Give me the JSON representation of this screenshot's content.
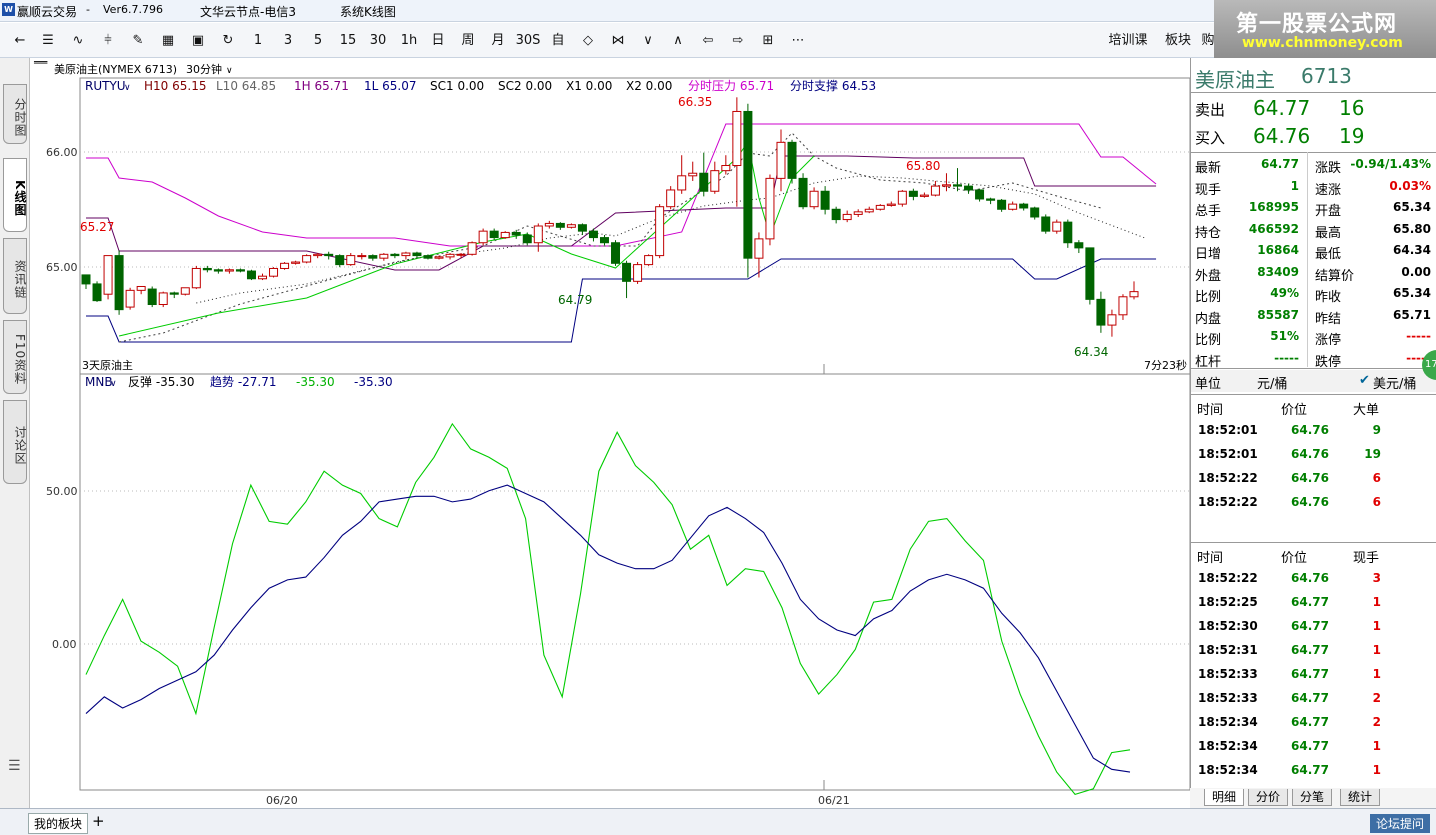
{
  "window": {
    "title": "赢顺云交易",
    "version": "Ver6.7.796",
    "node": "文华云节点-电信3",
    "mode": "系统K线图"
  },
  "logo": {
    "line1": "第一股票公式网",
    "line2": "www.chnmoney.com"
  },
  "toolbar": {
    "items": [
      "1",
      "3",
      "5",
      "15",
      "30",
      "1h",
      "日",
      "周",
      "月",
      "30S",
      "自"
    ],
    "right": [
      "培训课",
      "板块",
      "购"
    ]
  },
  "lefttabs": [
    "分时图",
    "K线图",
    "资讯链",
    "F10资料",
    "讨论区"
  ],
  "chart": {
    "header": {
      "symbol": "美原油主(NYMEX 6713)",
      "period": "30分钟"
    },
    "indicator_line": {
      "name": "RUTYU",
      "h10": "H10 65.15",
      "l10": "L10 64.85",
      "h1": "1H 65.71",
      "l1": "1L 65.07",
      "sc1": "SC1 0.00",
      "sc2": "SC2 0.00",
      "x1": "X1 0.00",
      "x2": "X2 0.00",
      "press": "分时压力 65.71",
      "support": "分时支撑 64.53"
    },
    "price_labels": {
      "p1": "66.00",
      "p2": "65.00"
    },
    "annotations": {
      "a1": "66.35",
      "a2": "65.80",
      "a3": "65.27",
      "a4": "64.79",
      "a5": "64.34",
      "a6": "3天原油主"
    },
    "countdown": "7分23秒",
    "mnb": {
      "name": "MNB",
      "rebound": "反弹 -35.30",
      "trend": "趋势 -27.71",
      "v3": "-35.30",
      "v4": "-35.30"
    },
    "mnb_labels": {
      "p1": "50.00",
      "p2": "0.00"
    },
    "dates": {
      "d1": "06/20",
      "d2": "06/21"
    }
  },
  "chart_data": {
    "type": "candlestick",
    "price_ylim": [
      64.2,
      66.5
    ],
    "candles": [
      [
        64.97,
        64.9,
        64.86,
        64.97
      ],
      [
        64.9,
        64.77,
        64.76,
        64.92
      ],
      [
        64.82,
        65.12,
        64.78,
        65.12
      ],
      [
        65.12,
        64.7,
        64.66,
        65.16
      ],
      [
        64.72,
        64.85,
        64.7,
        64.87
      ],
      [
        64.85,
        64.88,
        64.82,
        64.88
      ],
      [
        64.86,
        64.74,
        64.72,
        64.88
      ],
      [
        64.74,
        64.83,
        64.72,
        64.84
      ],
      [
        64.83,
        64.82,
        64.79,
        64.84
      ],
      [
        64.82,
        64.87,
        64.81,
        64.87
      ],
      [
        64.87,
        65.02,
        64.86,
        65.04
      ],
      [
        65.02,
        65.01,
        64.99,
        65.04
      ],
      [
        65.01,
        65.0,
        64.98,
        65.02
      ],
      [
        65.0,
        65.01,
        64.98,
        65.02
      ],
      [
        65.01,
        65.0,
        64.99,
        65.02
      ],
      [
        65.0,
        64.94,
        64.93,
        65.01
      ],
      [
        64.94,
        64.96,
        64.93,
        64.98
      ],
      [
        64.96,
        65.02,
        64.95,
        65.03
      ],
      [
        65.02,
        65.06,
        65.01,
        65.07
      ],
      [
        65.06,
        65.07,
        65.05,
        65.08
      ],
      [
        65.07,
        65.12,
        65.06,
        65.13
      ],
      [
        65.12,
        65.13,
        65.1,
        65.14
      ],
      [
        65.13,
        65.12,
        65.09,
        65.15
      ],
      [
        65.12,
        65.05,
        65.03,
        65.13
      ],
      [
        65.05,
        65.12,
        65.04,
        65.14
      ],
      [
        65.12,
        65.12,
        65.09,
        65.14
      ],
      [
        65.12,
        65.1,
        65.08,
        65.13
      ],
      [
        65.1,
        65.13,
        65.08,
        65.14
      ],
      [
        65.13,
        65.12,
        65.1,
        65.14
      ],
      [
        65.12,
        65.14,
        65.09,
        65.15
      ],
      [
        65.14,
        65.12,
        65.1,
        65.15
      ],
      [
        65.12,
        65.1,
        65.09,
        65.13
      ],
      [
        65.1,
        65.11,
        65.09,
        65.12
      ],
      [
        65.11,
        65.13,
        65.09,
        65.14
      ],
      [
        65.13,
        65.13,
        65.1,
        65.14
      ],
      [
        65.13,
        65.22,
        65.12,
        65.23
      ],
      [
        65.22,
        65.31,
        65.2,
        65.33
      ],
      [
        65.31,
        65.26,
        65.24,
        65.33
      ],
      [
        65.26,
        65.3,
        65.25,
        65.31
      ],
      [
        65.3,
        65.28,
        65.25,
        65.32
      ],
      [
        65.28,
        65.22,
        65.2,
        65.3
      ],
      [
        65.22,
        65.35,
        65.15,
        65.37
      ],
      [
        65.35,
        65.37,
        65.33,
        65.39
      ],
      [
        65.37,
        65.34,
        65.32,
        65.38
      ],
      [
        65.34,
        65.36,
        65.33,
        65.37
      ],
      [
        65.36,
        65.31,
        65.28,
        65.37
      ],
      [
        65.31,
        65.26,
        65.23,
        65.33
      ],
      [
        65.26,
        65.22,
        65.2,
        65.28
      ],
      [
        65.22,
        65.06,
        65.04,
        65.24
      ],
      [
        65.06,
        64.92,
        64.79,
        65.08
      ],
      [
        64.92,
        65.05,
        64.9,
        65.07
      ],
      [
        65.05,
        65.12,
        65.04,
        65.13
      ],
      [
        65.12,
        65.5,
        65.1,
        65.52
      ],
      [
        65.5,
        65.63,
        65.48,
        65.66
      ],
      [
        65.63,
        65.74,
        65.6,
        65.9
      ],
      [
        65.74,
        65.76,
        65.7,
        65.85
      ],
      [
        65.76,
        65.62,
        65.58,
        65.92
      ],
      [
        65.62,
        65.78,
        65.6,
        65.85
      ],
      [
        65.78,
        65.82,
        65.75,
        65.9
      ],
      [
        65.82,
        66.24,
        65.5,
        66.35
      ],
      [
        66.24,
        65.1,
        64.95,
        66.3
      ],
      [
        65.1,
        65.25,
        64.95,
        65.3
      ],
      [
        65.25,
        65.72,
        65.2,
        65.75
      ],
      [
        65.72,
        66.0,
        65.62,
        66.1
      ],
      [
        66.0,
        65.72,
        65.68,
        66.02
      ],
      [
        65.72,
        65.5,
        65.48,
        65.76
      ],
      [
        65.5,
        65.62,
        65.48,
        65.65
      ],
      [
        65.62,
        65.48,
        65.44,
        65.66
      ],
      [
        65.48,
        65.4,
        65.37,
        65.5
      ],
      [
        65.4,
        65.44,
        65.38,
        65.47
      ],
      [
        65.44,
        65.46,
        65.42,
        65.48
      ],
      [
        65.46,
        65.48,
        65.45,
        65.5
      ],
      [
        65.48,
        65.51,
        65.47,
        65.52
      ],
      [
        65.51,
        65.52,
        65.5,
        65.54
      ],
      [
        65.52,
        65.62,
        65.5,
        65.63
      ],
      [
        65.62,
        65.58,
        65.55,
        65.64
      ],
      [
        65.58,
        65.59,
        65.57,
        65.61
      ],
      [
        65.59,
        65.66,
        65.58,
        65.7
      ],
      [
        65.66,
        65.67,
        65.62,
        65.76
      ],
      [
        65.67,
        65.66,
        65.62,
        65.8
      ],
      [
        65.66,
        65.63,
        65.6,
        65.68
      ],
      [
        65.63,
        65.56,
        65.54,
        65.64
      ],
      [
        65.56,
        65.55,
        65.52,
        65.57
      ],
      [
        65.55,
        65.48,
        65.46,
        65.56
      ],
      [
        65.48,
        65.52,
        65.47,
        65.54
      ],
      [
        65.52,
        65.49,
        65.47,
        65.53
      ],
      [
        65.49,
        65.42,
        65.4,
        65.5
      ],
      [
        65.42,
        65.31,
        65.29,
        65.44
      ],
      [
        65.31,
        65.38,
        65.29,
        65.4
      ],
      [
        65.38,
        65.22,
        65.18,
        65.4
      ],
      [
        65.22,
        65.18,
        65.14,
        65.24
      ],
      [
        65.18,
        64.78,
        64.74,
        65.18
      ],
      [
        64.78,
        64.58,
        64.52,
        64.84
      ],
      [
        64.58,
        64.66,
        64.49,
        64.7
      ],
      [
        64.66,
        64.8,
        64.62,
        64.82
      ],
      [
        64.8,
        64.84,
        64.78,
        64.92
      ]
    ],
    "mnb_ylim": [
      -50,
      90
    ],
    "mnb_green": [
      -10,
      4,
      17,
      2,
      -2,
      -7,
      -24,
      7,
      37,
      58,
      45,
      44,
      52,
      63,
      58,
      55,
      46,
      43,
      59,
      68,
      80,
      71,
      68,
      64,
      46,
      -3,
      -18,
      19,
      63,
      77,
      65,
      59,
      51,
      35,
      40,
      22,
      28,
      27,
      14,
      -6,
      -17,
      -10,
      -1,
      16,
      17,
      35,
      45,
      46,
      38,
      31,
      2,
      -17,
      -32,
      -45,
      -53,
      -51,
      -38,
      -37
    ],
    "mnb_blue": [
      -24,
      -18,
      -22,
      -19,
      -15,
      -12,
      -9,
      -3,
      6,
      14,
      21,
      24,
      25,
      32,
      40,
      45,
      52,
      53,
      54,
      54,
      52,
      53,
      56,
      58,
      55,
      52,
      46,
      40,
      33,
      30,
      28,
      28,
      31,
      39,
      47,
      50,
      46,
      41,
      30,
      17,
      10,
      6,
      4,
      10,
      13,
      20,
      24,
      26,
      24,
      21,
      12,
      5,
      -4,
      -16,
      -28,
      -40,
      -44,
      -45
    ],
    "ma_dash": [
      65.0,
      64.98,
      64.9,
      64.88,
      64.88,
      64.9,
      64.9,
      64.92,
      64.94,
      64.96,
      65.0,
      65.02,
      65.05,
      65.08,
      65.1,
      65.14,
      65.18,
      65.2,
      65.2,
      65.15,
      65.08,
      65.06,
      65.1,
      65.22,
      65.35,
      65.5,
      65.6,
      65.75,
      65.82,
      65.85,
      65.82,
      65.75,
      65.72,
      65.7,
      65.72,
      65.75,
      65.78,
      65.79,
      65.78,
      65.76,
      65.72,
      65.66,
      65.58,
      65.48,
      65.34,
      65.22,
      65.16
    ]
  },
  "quote": {
    "title": "美原油主",
    "code": "6713",
    "sell_label": "卖出",
    "sell_price": "64.77",
    "sell_vol": "16",
    "buy_label": "买入",
    "buy_price": "64.76",
    "buy_vol": "19",
    "rows": [
      {
        "l": "最新",
        "v": "64.77",
        "l2": "涨跌",
        "v2": "-0.94/1.43%"
      },
      {
        "l": "现手",
        "v": "1",
        "l2": "速涨",
        "v2": "0.03%"
      },
      {
        "l": "总手",
        "v": "168995",
        "l2": "开盘",
        "v2": "65.34"
      },
      {
        "l": "持仓",
        "v": "466592",
        "l2": "最高",
        "v2": "65.80"
      },
      {
        "l": "日增",
        "v": "16864",
        "l2": "最低",
        "v2": "64.34"
      },
      {
        "l": "外盘",
        "v": "83409",
        "l2": "结算价",
        "v2": "0.00"
      },
      {
        "l": "比例",
        "v": "49%",
        "l2": "昨收",
        "v2": "65.34"
      },
      {
        "l": "内盘",
        "v": "85587",
        "l2": "昨结",
        "v2": "65.71"
      },
      {
        "l": "比例",
        "v": "51%",
        "l2": "涨停",
        "v2": "-----"
      },
      {
        "l": "杠杆",
        "v": "-----",
        "l2": "跌停",
        "v2": "-----"
      }
    ],
    "unit_label": "单位",
    "unit": "元/桶",
    "unit_alt": "美元/桶",
    "big_header": [
      "时间",
      "价位",
      "大单"
    ],
    "big": [
      [
        "18:52:01",
        "64.76",
        "9"
      ],
      [
        "18:52:01",
        "64.76",
        "19"
      ],
      [
        "18:52:22",
        "64.76",
        "6"
      ],
      [
        "18:52:22",
        "64.76",
        "6"
      ]
    ],
    "tick_header": [
      "时间",
      "价位",
      "现手"
    ],
    "ticks": [
      [
        "18:52:22",
        "64.76",
        "3"
      ],
      [
        "18:52:25",
        "64.77",
        "1"
      ],
      [
        "18:52:30",
        "64.77",
        "1"
      ],
      [
        "18:52:31",
        "64.77",
        "1"
      ],
      [
        "18:52:33",
        "64.77",
        "1"
      ],
      [
        "18:52:33",
        "64.77",
        "2"
      ],
      [
        "18:52:34",
        "64.77",
        "2"
      ],
      [
        "18:52:34",
        "64.77",
        "1"
      ],
      [
        "18:52:34",
        "64.77",
        "1"
      ]
    ],
    "tabs": [
      "明细",
      "分价",
      "分笔",
      "统计"
    ]
  },
  "bottom": {
    "tab": "我的板块",
    "plus": "+",
    "forum": "论坛提问"
  },
  "badge": "17"
}
